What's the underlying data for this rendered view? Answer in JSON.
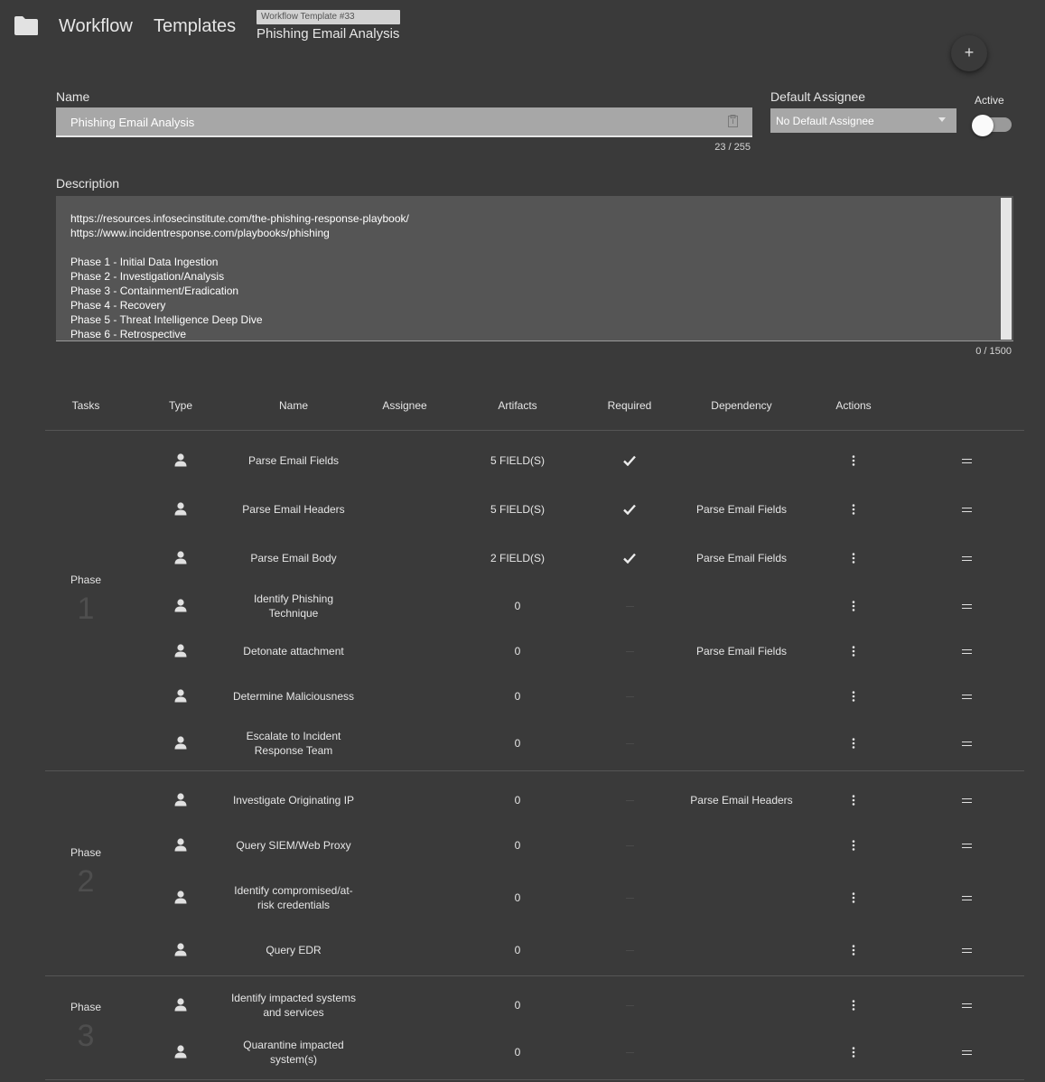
{
  "header": {
    "folder_icon": "folder-icon",
    "crumb_workflow": "Workflow",
    "crumb_templates": "Templates",
    "template_badge": "Workflow Template #33",
    "template_title": "Phishing Email Analysis",
    "add_icon": "+"
  },
  "form": {
    "name_label": "Name",
    "name_value": "Phishing Email Analysis",
    "name_counter": "23 / 255",
    "assignee_label": "Default Assignee",
    "assignee_value": "No Default Assignee",
    "active_label": "Active",
    "active_on": false,
    "description_label": "Description",
    "description_lines": [
      "https://resources.infosecinstitute.com/the-phishing-response-playbook/",
      "https://www.incidentresponse.com/playbooks/phishing",
      "",
      "Phase 1 - Initial Data Ingestion",
      "Phase 2 - Investigation/Analysis",
      "Phase 3 - Containment/Eradication",
      "Phase 4 - Recovery",
      "Phase 5 - Threat Intelligence Deep Dive",
      "Phase 6 - Retrospective"
    ],
    "description_counter": "0 / 1500"
  },
  "table": {
    "headers": {
      "tasks": "Tasks",
      "type": "Type",
      "name": "Name",
      "assignee": "Assignee",
      "artifacts": "Artifacts",
      "required": "Required",
      "dependency": "Dependency",
      "actions": "Actions"
    },
    "phase_word": "Phase",
    "phases": [
      {
        "number": "1",
        "tasks": [
          {
            "name": "Parse Email Fields",
            "artifacts": "5 FIELD(S)",
            "required": true,
            "dependency": ""
          },
          {
            "name": "Parse Email Headers",
            "artifacts": "5 FIELD(S)",
            "required": true,
            "dependency": "Parse Email Fields"
          },
          {
            "name": "Parse Email Body",
            "artifacts": "2 FIELD(S)",
            "required": true,
            "dependency": "Parse Email Fields"
          },
          {
            "name": "Identify Phishing Technique",
            "artifacts": "0",
            "required": false,
            "dependency": ""
          },
          {
            "name": "Detonate attachment",
            "artifacts": "0",
            "required": false,
            "dependency": "Parse Email Fields"
          },
          {
            "name": "Determine Maliciousness",
            "artifacts": "0",
            "required": false,
            "dependency": ""
          },
          {
            "name": "Escalate to Incident Response Team",
            "artifacts": "0",
            "required": false,
            "dependency": ""
          }
        ]
      },
      {
        "number": "2",
        "tasks": [
          {
            "name": "Investigate Originating IP",
            "artifacts": "0",
            "required": false,
            "dependency": "Parse Email Headers"
          },
          {
            "name": "Query SIEM/Web Proxy",
            "artifacts": "0",
            "required": false,
            "dependency": ""
          },
          {
            "name": "Identify compromised/at-risk credentials",
            "artifacts": "0",
            "required": false,
            "dependency": ""
          },
          {
            "name": "Query EDR",
            "artifacts": "0",
            "required": false,
            "dependency": ""
          }
        ]
      },
      {
        "number": "3",
        "tasks": [
          {
            "name": "Identify impacted systems and services",
            "artifacts": "0",
            "required": false,
            "dependency": ""
          },
          {
            "name": "Quarantine impacted system(s)",
            "artifacts": "0",
            "required": false,
            "dependency": ""
          }
        ]
      }
    ]
  }
}
